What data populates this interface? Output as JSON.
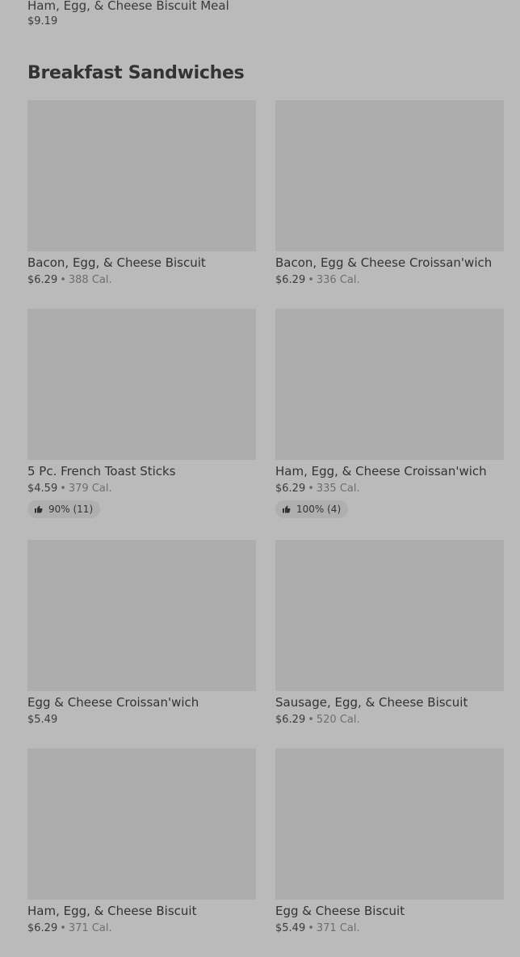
{
  "previous_section_last_item": {
    "name": "Ham, Egg, & Cheese Biscuit Meal",
    "price": "$9.19"
  },
  "section": {
    "title": "Breakfast Sandwiches",
    "items": [
      {
        "name": "Bacon, Egg, & Cheese Biscuit",
        "price": "$6.29",
        "sep": "•",
        "calories": "388 Cal."
      },
      {
        "name": "Bacon, Egg & Cheese Croissan'wich",
        "price": "$6.29",
        "sep": "•",
        "calories": "336 Cal."
      },
      {
        "name": "5 Pc. French Toast Sticks",
        "price": "$4.59",
        "sep": "•",
        "calories": "379 Cal.",
        "rating": "90% (11)",
        "rating_icon": "thumbs-up-icon"
      },
      {
        "name": "Ham, Egg, & Cheese Croissan'wich",
        "price": "$6.29",
        "sep": "•",
        "calories": "335 Cal.",
        "rating": "100% (4)",
        "rating_icon": "thumbs-up-icon"
      },
      {
        "name": "Egg & Cheese Croissan'wich",
        "price": "$5.49"
      },
      {
        "name": "Sausage, Egg, & Cheese Biscuit",
        "price": "$6.29",
        "sep": "•",
        "calories": "520 Cal."
      },
      {
        "name": "Ham, Egg, & Cheese Biscuit",
        "price": "$6.29",
        "sep": "•",
        "calories": "371 Cal."
      },
      {
        "name": "Egg & Cheese Biscuit",
        "price": "$5.49",
        "sep": "•",
        "calories": "371 Cal."
      }
    ]
  },
  "colors": {
    "background": "#bababa",
    "image_placeholder": "#adadad",
    "badge_background": "#afafaf",
    "text_primary": "#333333",
    "text_muted": "#6e6e6e"
  }
}
